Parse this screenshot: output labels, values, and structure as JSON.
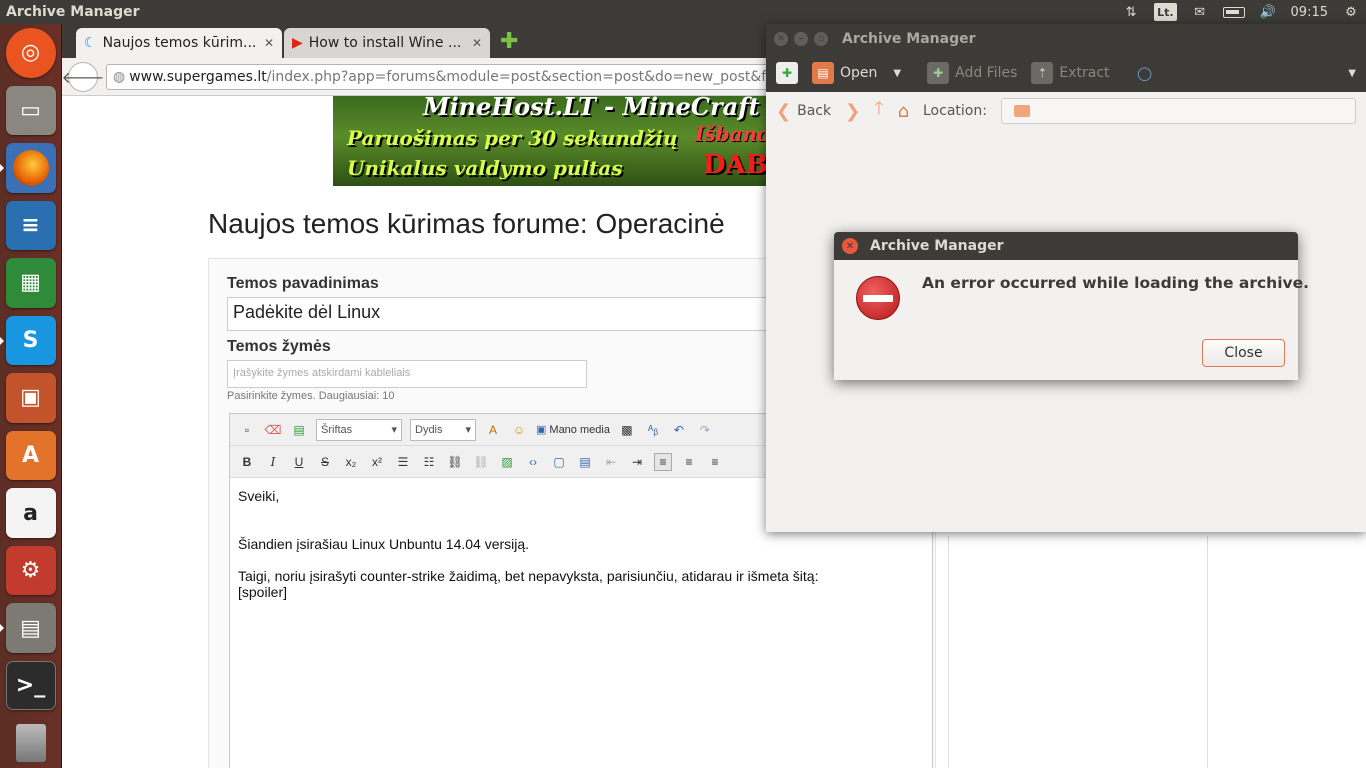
{
  "topbar": {
    "title": "Archive Manager",
    "keyboard": "Lt.",
    "clock": "09:15"
  },
  "launcher": {
    "items": [
      "ubuntu-dash",
      "files",
      "firefox",
      "libreoffice-writer",
      "libreoffice-calc",
      "skype",
      "libreoffice-impress",
      "software-center",
      "amazon",
      "system-settings",
      "scanner",
      "terminal",
      "trash"
    ]
  },
  "browser": {
    "tabs": [
      {
        "label": "Naujos temos kūrim..."
      },
      {
        "label": "How to install Wine ..."
      }
    ],
    "url_domain": "www.supergames.lt",
    "url_path": "/index.php?app=forums&module=post&section=post&do=new_post&f=189"
  },
  "banner": {
    "line1": "MineHost.LT - MineCraft s",
    "line2": "Paruošimas per 30 sekundžių",
    "line3": "Unikalus valdymo pultas",
    "line4": "Išband",
    "line5": "DAB"
  },
  "page": {
    "title": "Naujos temos kūrimas forume: Operacinė",
    "topic_label": "Temos pavadinimas",
    "topic_value": "Padėkite dėl Linux",
    "tags_label": "Temos žymės",
    "tags_placeholder": "Įrašykite žymes atskirdami kableliais",
    "tags_hint": "Pasirinkite žymes. Daugiausiai: 10"
  },
  "editor": {
    "font_select": "Šriftas",
    "size_select": "Dydis",
    "media_button": "Mano media",
    "body": {
      "line1": "Sveiki,",
      "line2": "Šiandien įsirašiau Linux Unbuntu 14.04 versiją.",
      "line3": "Taigi, noriu įsirašyti counter-strike žaidimą, bet nepavyksta, parisiunčiu, atidarau ir išmeta šitą:",
      "line4": "[spoiler]"
    }
  },
  "archive_manager": {
    "title": "Archive Manager",
    "toolbar": {
      "open": "Open",
      "add_files": "Add Files",
      "extract": "Extract"
    },
    "location": {
      "back": "Back",
      "label": "Location:"
    }
  },
  "dialog": {
    "title": "Archive Manager",
    "message": "An error occurred while loading the archive.",
    "close": "Close"
  }
}
